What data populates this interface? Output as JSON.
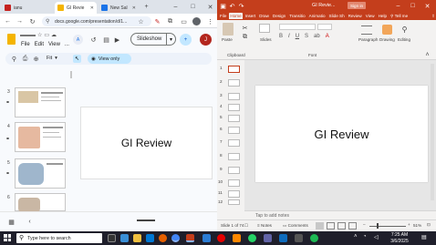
{
  "chrome": {
    "tabs": [
      {
        "label": "ianu",
        "color": "#c5221f"
      },
      {
        "label": "GI Revie",
        "color": "#f4b400"
      },
      {
        "label": "New Sal",
        "color": "#1a73e8"
      }
    ],
    "url": "docs.google.com/presentation/d/1..."
  },
  "slides": {
    "menu": [
      "File",
      "Edit",
      "View"
    ],
    "menu_more": "...",
    "slideshow_label": "Slideshow",
    "avatar_letter": "J",
    "zoom": "Fit",
    "view_only": "View only",
    "thumb_numbers": [
      "3",
      "4",
      "5",
      "6"
    ],
    "title": "GI Review"
  },
  "ppt": {
    "title": "GI Revie...",
    "signin": "Sign in",
    "tabs": [
      "File",
      "Home",
      "Insert",
      "Draw",
      "Design",
      "Transitio",
      "Animatio",
      "Slide Sh",
      "Review",
      "View",
      "Help"
    ],
    "active_tab": "Home",
    "tell_me": "Tell me",
    "ribbon": {
      "paste": "Paste",
      "slides": "Slides",
      "clipboard": "Clipboard",
      "font": "Font",
      "paragraph": "Paragraph",
      "drawing": "Drawing",
      "editing": "Editing"
    },
    "slide_numbers": [
      "1",
      "2",
      "3",
      "4",
      "5",
      "6",
      "7",
      "8",
      "9",
      "10",
      "11",
      "12",
      "13"
    ],
    "slide_title": "GI Review",
    "notes_placeholder": "Tap to add notes",
    "status": {
      "slide_of": "Slide 1 of 74",
      "notes": "Notes",
      "comments": "Comments",
      "zoom": "51%"
    }
  },
  "taskbar": {
    "search_placeholder": "Type here to search",
    "time": "7:25 AM",
    "date": "3/6/2025"
  },
  "colors": {
    "ppt_brand": "#c43e1c",
    "chrome_tabbar": "#dee3ea",
    "taskbar": "#1f1f2b"
  }
}
